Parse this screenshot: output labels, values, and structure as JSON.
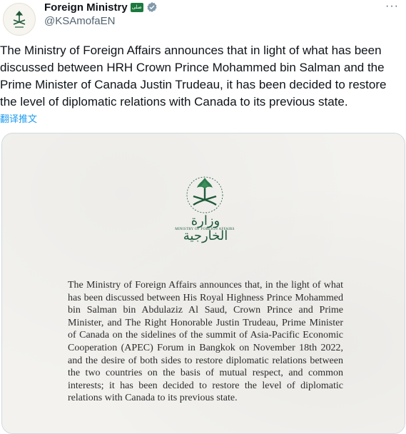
{
  "account": {
    "display_name": "Foreign Ministry",
    "handle": "@KSAmofaEN",
    "flag_text": "صلى"
  },
  "tweet": {
    "text": "The Ministry of Foreign Affairs announces that in light of what has been discussed between HRH Crown Prince Mohammed bin Salman and the Prime Minister of Canada Justin Trudeau, it has been decided to restore the level of diplomatic relations with Canada to its previous state.",
    "translate_label": "翻译推文"
  },
  "menu": {
    "more_label": "···"
  },
  "media": {
    "arabic_title": "وزارة الخارجية",
    "subtitle": "MINISTRY OF FOREIGN AFFAIRS",
    "letter_text": "The Ministry of Foreign Affairs announces that, in the light of what has been discussed between His Royal Highness Prince Mohammed bin Salman bin Abdulaziz Al Saud, Crown Prince and Prime Minister, and The Right Honorable Justin Trudeau, Prime Minister of Canada on the sidelines of the summit of Asia-Pacific Economic Cooperation (APEC) Forum in Bangkok on November 18th 2022, and the desire of both sides to restore diplomatic relations between the two countries on the basis of mutual respect, and common interests; it has been decided to restore the level of diplomatic relations with Canada to its previous state."
  },
  "colors": {
    "accent": "#1d9bf0",
    "emblem_green": "#1f5a3a",
    "flag_green": "#1b7a3e"
  }
}
